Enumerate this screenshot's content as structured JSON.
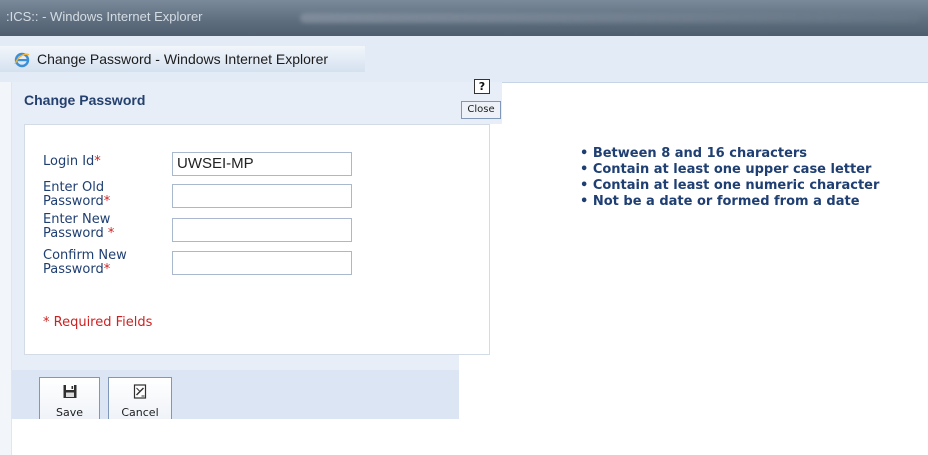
{
  "background_window": {
    "title": ":ICS:: - Windows Internet Explorer"
  },
  "window": {
    "title": "Change Password - Windows Internet Explorer"
  },
  "page": {
    "heading": "Change Password",
    "help_label": "?",
    "close_label": "Close"
  },
  "form": {
    "fields": [
      {
        "label_line1": "Login Id",
        "label_line2": "",
        "required_mark": "*",
        "value": "UWSEI-MP"
      },
      {
        "label_line1": "Enter Old",
        "label_line2": "Password",
        "required_mark": "*",
        "value": ""
      },
      {
        "label_line1": "Enter New",
        "label_line2": "Password ",
        "required_mark": "*",
        "value": ""
      },
      {
        "label_line1": "Confirm New",
        "label_line2": "Password",
        "required_mark": "*",
        "value": ""
      }
    ],
    "required_note": "* Required Fields"
  },
  "password_rules": [
    "• Between 8 and 16 characters",
    "• Contain at least one upper case letter",
    "• Contain at least one numeric character",
    "• Not be a date or formed from a date"
  ],
  "toolbar": {
    "save_label": "Save",
    "cancel_label": "Cancel"
  },
  "colors": {
    "heading": "#24406e",
    "label": "#1f3f72",
    "required": "#cc2222",
    "panel_bg": "#e8eef7",
    "footer_bg": "#dce5f3"
  }
}
